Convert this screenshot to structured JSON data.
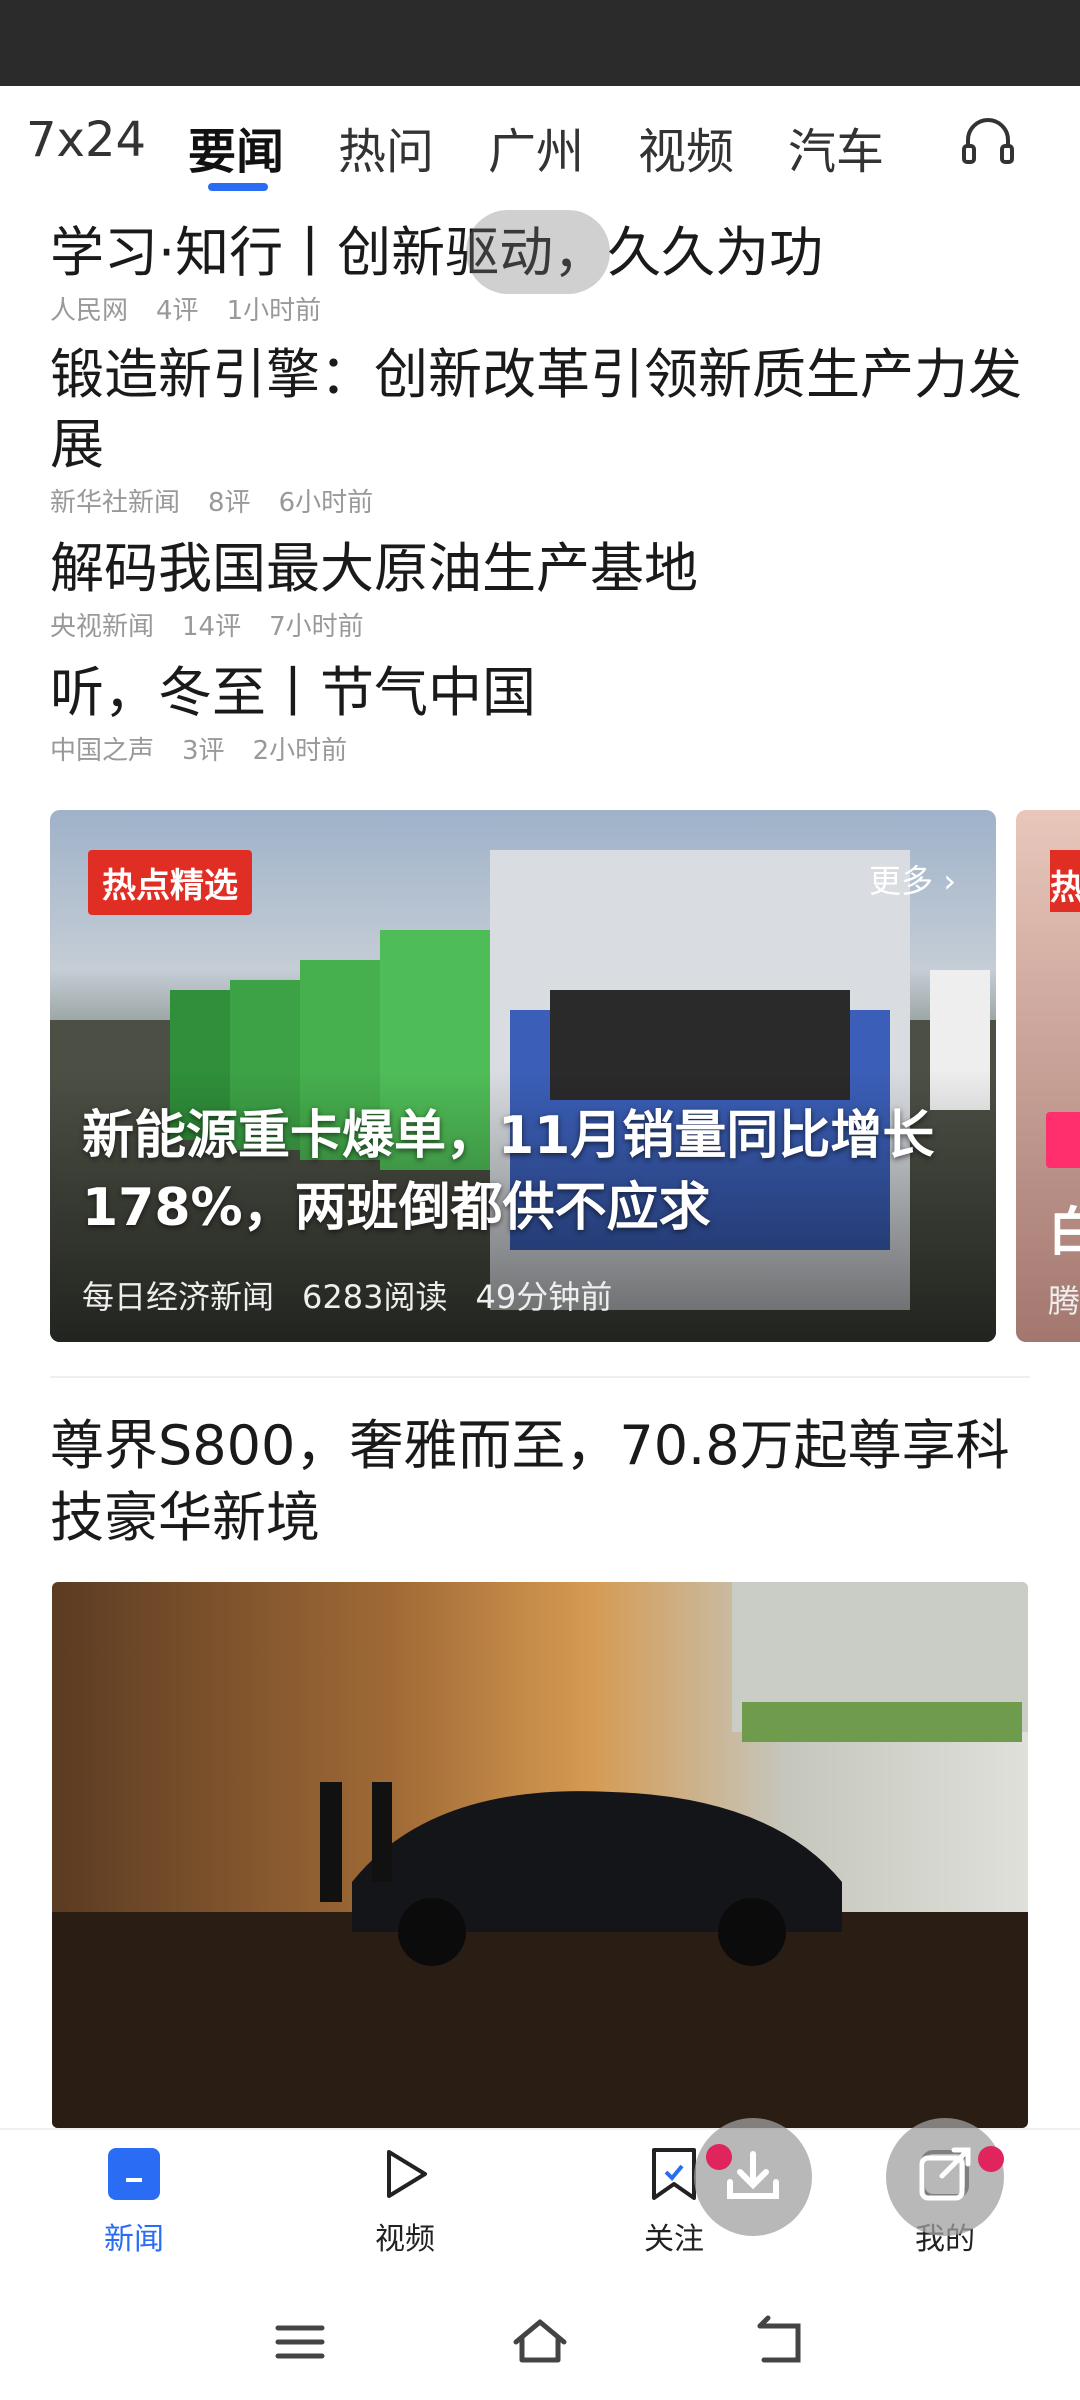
{
  "tabs": [
    {
      "label": "7x24"
    },
    {
      "label": "要闻",
      "active": true
    },
    {
      "label": "热问"
    },
    {
      "label": "广州"
    },
    {
      "label": "视频"
    },
    {
      "label": "汽车"
    }
  ],
  "headphone_icon": "headphones-icon",
  "news": [
    {
      "title": "学习·知行丨创新驱动，久久为功",
      "source": "人民网",
      "comments": "4评",
      "time": "1小时前"
    },
    {
      "title": "锻造新引擎：创新改革引领新质生产力发展",
      "source": "新华社新闻",
      "comments": "8评",
      "time": "6小时前"
    },
    {
      "title": "解码我国最大原油生产基地",
      "source": "央视新闻",
      "comments": "14评",
      "time": "7小时前"
    },
    {
      "title": "听，冬至丨节气中国",
      "source": "中国之声",
      "comments": "3评",
      "time": "2小时前"
    }
  ],
  "featured": {
    "tag": "热点精选",
    "more": "更多",
    "title": "新能源重卡爆单，11月销量同比增长178%，两班倒都供不应求",
    "source": "每日经济新闻",
    "reads": "6283阅读",
    "time": "49分钟前"
  },
  "next_card": {
    "tag": "热",
    "title_start": "白",
    "source_start": "腾"
  },
  "ad": {
    "title": "尊界S800，奢雅而至，70.8万起尊享科技豪华新境"
  },
  "bottom_nav": [
    {
      "label": "新闻",
      "icon": "news-icon",
      "active": true
    },
    {
      "label": "视频",
      "icon": "play-icon"
    },
    {
      "label": "关注",
      "icon": "bookmark-icon"
    },
    {
      "label": "我的",
      "icon": "profile-icon"
    }
  ],
  "colors": {
    "accent": "#2a6df4",
    "tag_red": "#e02e24",
    "notify": "#e0245e"
  }
}
